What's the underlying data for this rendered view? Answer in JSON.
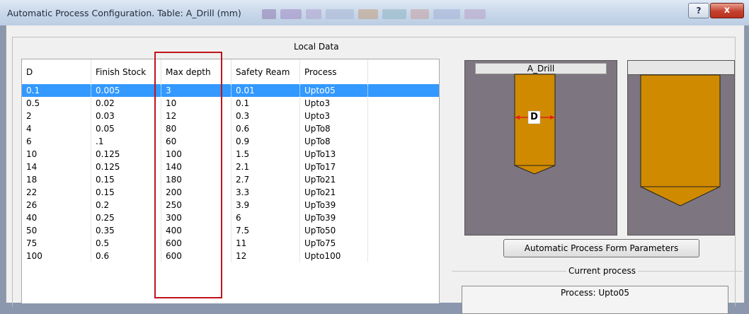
{
  "window": {
    "title": "Automatic Process Configuration. Table: A_Drill (mm)",
    "help_label": "?",
    "close_label": "x"
  },
  "local_data": {
    "label": "Local Data",
    "columns": [
      "D",
      "Finish Stock",
      "Max depth",
      "Safety Ream",
      "Process"
    ],
    "rows": [
      [
        "0.1",
        "0.005",
        "3",
        "0.01",
        "Upto05"
      ],
      [
        "0.5",
        "0.02",
        "10",
        "0.1",
        "Upto3"
      ],
      [
        "2",
        "0.03",
        "12",
        "0.3",
        "Upto3"
      ],
      [
        "4",
        "0.05",
        "80",
        "0.6",
        "UpTo8"
      ],
      [
        "6",
        ".1",
        "60",
        "0.9",
        "UpTo8"
      ],
      [
        "10",
        "0.125",
        "100",
        "1.5",
        "UpTo13"
      ],
      [
        "14",
        "0.125",
        "140",
        "2.1",
        "UpTo17"
      ],
      [
        "18",
        "0.15",
        "180",
        "2.7",
        "UpTo21"
      ],
      [
        "22",
        "0.15",
        "200",
        "3.3",
        "UpTo21"
      ],
      [
        "26",
        "0.2",
        "250",
        "3.9",
        "UpTo39"
      ],
      [
        "40",
        "0.25",
        "300",
        "6",
        "UpTo39"
      ],
      [
        "50",
        "0.35",
        "400",
        "7.5",
        "UpTo50"
      ],
      [
        "75",
        "0.5",
        "600",
        "11",
        "UpTo75"
      ],
      [
        "100",
        "0.6",
        "600",
        "12",
        "Upto100"
      ]
    ],
    "selected_row": 0
  },
  "preview": {
    "tool_title": "A_Drill",
    "dimension_label": "D"
  },
  "form_button_label": "Automatic Process Form Parameters",
  "current_process": {
    "label": "Current process",
    "process_text": "Process: Upto05"
  },
  "colors": {
    "selection": "#3399ff",
    "highlight_box": "#c0141b",
    "tool_fill": "#d08a00",
    "stock_fill": "#7d7680"
  }
}
